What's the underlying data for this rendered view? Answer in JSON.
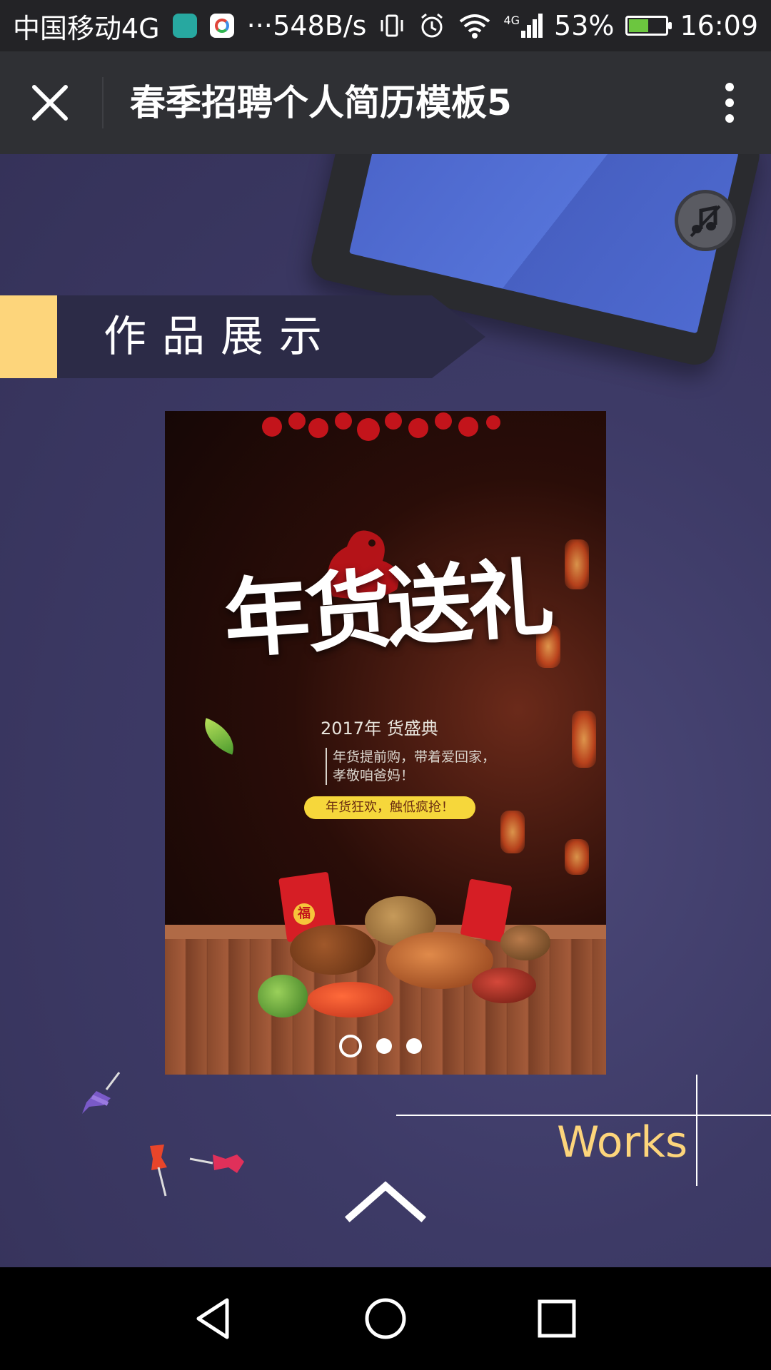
{
  "status_bar": {
    "carrier": "中国移动4G",
    "more": "···",
    "net_speed": "548B/s",
    "network_type": "4G",
    "battery_pct": "53%",
    "battery_level": 0.53,
    "time": "16:09"
  },
  "app_bar": {
    "title": "春季招聘个人简历模板5"
  },
  "section": {
    "title": "作品展示"
  },
  "poster": {
    "headline": "年货送礼",
    "year_line": "2017年 货盛典",
    "desc": "年货提前购，带着爱回家，\n孝敬咱爸妈！",
    "tag": "年货狂欢，触低疯抢！",
    "badge": "福"
  },
  "carousel": {
    "count": 3,
    "active_index": 0
  },
  "works_label": "Works",
  "colors": {
    "accent_yellow": "#fdd57b",
    "background": "#3d3a66",
    "banner": "#2c2b47",
    "app_bar": "#2f3034"
  },
  "icons": {
    "close": "close-icon",
    "more": "more-vert-icon",
    "music": "music-off-icon",
    "up": "chevron-up-icon",
    "back": "nav-back-icon",
    "home": "nav-home-icon",
    "recent": "nav-recents-icon"
  }
}
